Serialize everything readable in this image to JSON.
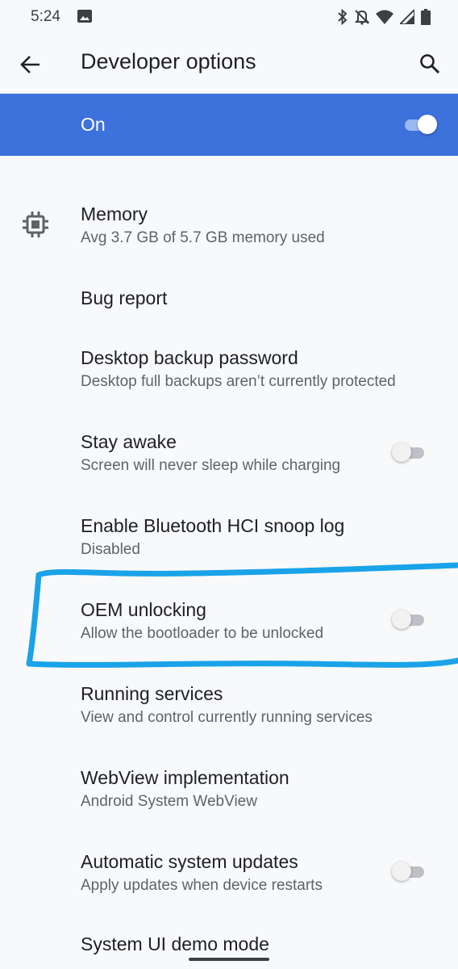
{
  "status_bar": {
    "time": "5:24",
    "icons": [
      "gallery-icon",
      "bluetooth-icon",
      "notifications-off-icon",
      "wifi-icon",
      "signal-icon",
      "battery-icon"
    ]
  },
  "app_bar": {
    "title": "Developer options",
    "back_icon": "back-arrow-icon",
    "search_icon": "search-icon"
  },
  "master_switch": {
    "label": "On",
    "checked": true,
    "accent": "#3d71dc"
  },
  "settings": [
    {
      "title": "Memory",
      "subtitle": "Avg 3.7 GB of 5.7 GB memory used",
      "icon": "memory-chip-icon"
    },
    {
      "title": "Bug report"
    },
    {
      "title": "Desktop backup password",
      "subtitle": "Desktop full backups aren’t currently protected"
    },
    {
      "title": "Stay awake",
      "subtitle": "Screen will never sleep while charging",
      "switch": false
    },
    {
      "title": "Enable Bluetooth HCI snoop log",
      "subtitle": "Disabled"
    },
    {
      "title": "OEM unlocking",
      "subtitle": "Allow the bootloader to be unlocked",
      "switch": false
    },
    {
      "title": "Running services",
      "subtitle": "View and control currently running services"
    },
    {
      "title": "WebView implementation",
      "subtitle": "Android System WebView"
    },
    {
      "title": "Automatic system updates",
      "subtitle": "Apply updates when device restarts",
      "switch": false
    },
    {
      "title": "System UI demo mode"
    }
  ],
  "annotation": {
    "color": "#1aa3e8"
  }
}
